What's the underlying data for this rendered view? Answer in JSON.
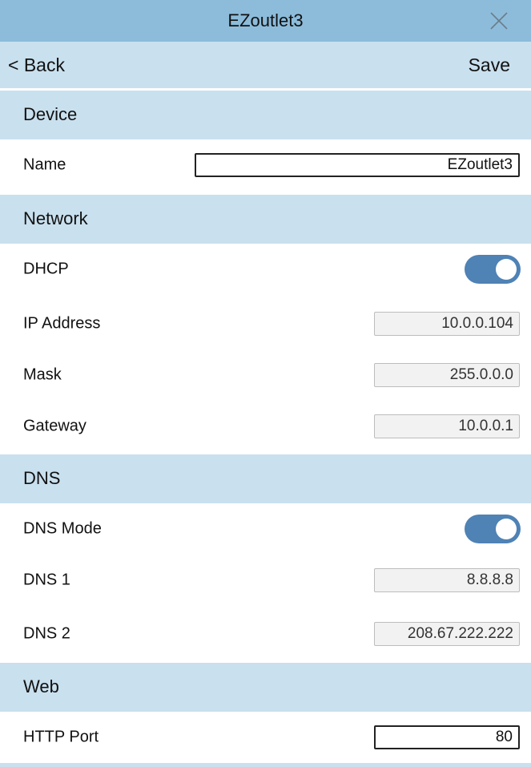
{
  "window": {
    "title": "EZoutlet3",
    "close_icon": "close-icon"
  },
  "nav": {
    "back_label": "< Back",
    "save_label": "Save"
  },
  "sections": {
    "device": "Device",
    "network": "Network",
    "dns": "DNS",
    "web": "Web"
  },
  "device": {
    "name_label": "Name",
    "name_value": "EZoutlet3"
  },
  "network": {
    "dhcp_label": "DHCP",
    "dhcp_enabled": true,
    "ip_label": "IP Address",
    "ip_value": "10.0.0.104",
    "mask_label": "Mask",
    "mask_value": "255.0.0.0",
    "gateway_label": "Gateway",
    "gateway_value": "10.0.0.1"
  },
  "dns": {
    "mode_label": "DNS Mode",
    "mode_enabled": true,
    "dns1_label": "DNS 1",
    "dns1_value": "8.8.8.8",
    "dns2_label": "DNS 2",
    "dns2_value": "208.67.222.222"
  },
  "web": {
    "http_port_label": "HTTP Port",
    "http_port_value": "80"
  },
  "colors": {
    "title_bar": "#8dbcdb",
    "section_bar": "#c9e0ee",
    "toggle_on": "#4f82b5"
  }
}
